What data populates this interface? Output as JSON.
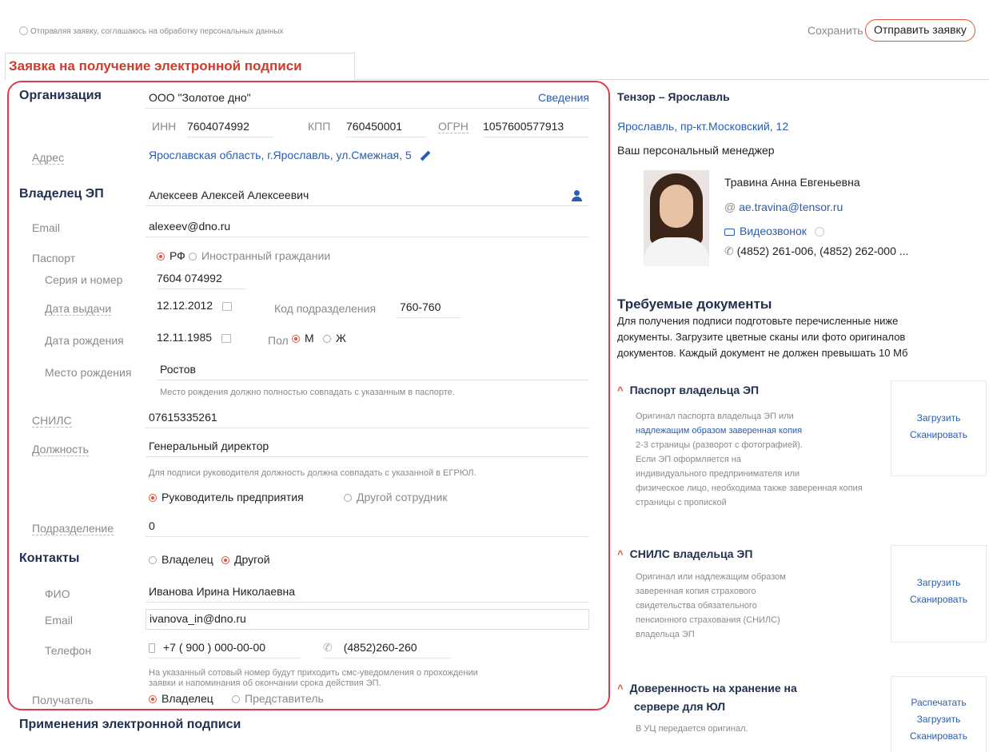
{
  "topbar": {
    "consent_text": "Отправляя заявку, соглашаюсь на обработку персональных данных",
    "save_label": "Сохранить",
    "submit_label": "Отправить заявку"
  },
  "tab": {
    "label": "Заявка на получение электронной подписи"
  },
  "org": {
    "heading": "Организация",
    "name": "ООО \"Золотое дно\"",
    "details_link": "Сведения",
    "inn_label": "ИНН",
    "inn": "7604074992",
    "kpp_label": "КПП",
    "kpp": "760450001",
    "ogrn_label": "ОГРН",
    "ogrn": "1057600577913",
    "address_label": "Адрес",
    "address": "Ярославская область, г.Ярославль, ул.Смежная, 5"
  },
  "owner": {
    "heading": "Владелец ЭП",
    "name": "Алексеев Алексей Алексеевич",
    "email_label": "Email",
    "email": "alexeev@dno.ru",
    "passport_label": "Паспорт",
    "passport_rf": "РФ",
    "passport_foreign": "Иностранный граждании",
    "series_label": "Серия и номер",
    "series": "7604 074992",
    "issue_date_label": "Дата выдачи",
    "issue_date": "12.12.2012",
    "dept_code_label": "Код подразделения",
    "dept_code": "760-760",
    "birth_date_label": "Дата рождения",
    "birth_date": "12.11.1985",
    "sex_label": "Пол",
    "sex_m": "М",
    "sex_f": "Ж",
    "birth_place_label": "Место рождения",
    "birth_place": "Ростов",
    "birth_place_hint": "Место рождения должно полностью совпадать с указанным в паспорте.",
    "snils_label": "СНИЛС",
    "snils": "07615335261",
    "position_label": "Должность",
    "position": "Генеральный директор",
    "position_hint": "Для подписи руководителя должность должна совпадать с указанной в ЕГРЮЛ.",
    "role_head": "Руководитель предприятия",
    "role_other": "Другой сотрудник",
    "division_label": "Подразделение",
    "division": "0"
  },
  "contacts": {
    "heading": "Контакты",
    "opt_owner": "Владелец",
    "opt_other": "Другой",
    "fio_label": "ФИО",
    "fio": "Иванова Ирина Николаевна",
    "email_label": "Email",
    "email": "ivanova_in@dno.ru",
    "phone_label": "Телефон",
    "mobile": "+7 ( 900 ) 000-00-00",
    "landline": "(4852)260-260",
    "phone_hint_1": "На указанный сотовый номер будут приходить смс-уведомления о прохождении",
    "phone_hint_2": "заявки и напоминания об окончании срока действия ЭП.",
    "recipient_label": "Получатель",
    "recipient_owner": "Владелец",
    "recipient_rep": "Представитель"
  },
  "footer_heading": "Применения электронной подписи",
  "sidebar": {
    "office": "Тензор – Ярославль",
    "office_address": "Ярославль, пр-кт.Московский, 12",
    "manager_title": "Ваш персональный менеджер",
    "manager_name": "Травина Анна Евгеньевна",
    "manager_email": "ae.travina@tensor.ru",
    "video_call": "Видеозвонок",
    "manager_phone": "(4852) 261-006, (4852) 262-000 ...",
    "docs_heading": "Требуемые документы",
    "docs_intro_1": "Для получения подписи подготовьте перечисленные ниже",
    "docs_intro_2": "документы. Загрузите цветные сканы или фото оригиналов",
    "docs_intro_3": "документов. Каждый документ не должен превышать 10 Мб",
    "docs": [
      {
        "title": "Паспорт владельца ЭП",
        "lines": [
          "Оригинал паспорта владельца ЭП или",
          "надлежащим образом заверенная копия",
          "2-3 страницы (разворот с фотографией).",
          "Если ЭП оформляется на",
          "индивидуального предпринимателя или",
          "физическое лицо, необходима также заверенная копия",
          "страницы с пропиской"
        ],
        "actions": [
          "Загрузить",
          "Сканировать"
        ]
      },
      {
        "title": "СНИЛС владельца ЭП",
        "lines": [
          "Оригинал или надлежащим образом",
          "заверенная копия страхового",
          "свидетельства обязательного",
          "пенсионного страхования (СНИЛС)",
          "владельца ЭП"
        ],
        "actions": [
          "Загрузить",
          "Сканировать"
        ]
      },
      {
        "title_1": "Доверенность на хранение на",
        "title_2": "сервере для ЮЛ",
        "lines": [
          "В УЦ передается оригинал."
        ],
        "actions": [
          "Распечатать",
          "Загрузить",
          "Сканировать"
        ]
      }
    ]
  }
}
